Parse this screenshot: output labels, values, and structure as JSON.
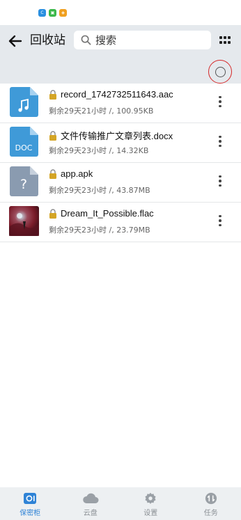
{
  "status_bar": {
    "icons": [
      {
        "name": "app-icon-1",
        "color": "#2a8fe0",
        "glyph": "ℂ"
      },
      {
        "name": "app-icon-2",
        "color": "#3bb84a",
        "glyph": "▣"
      },
      {
        "name": "app-icon-3",
        "color": "#f0a020",
        "glyph": "◈"
      }
    ]
  },
  "header": {
    "title": "回收站",
    "search_placeholder": "搜索"
  },
  "files": [
    {
      "name": "record_1742732511643.aac",
      "meta": "剩余29天21小时 /, 100.95KB",
      "type": "audio",
      "thumb_color": "#3f9ad8"
    },
    {
      "name": "文件传输推广文章列表.docx",
      "meta": "剩余29天23小时 /, 14.32KB",
      "type": "doc",
      "thumb_label": "DOC",
      "thumb_color": "#3f9ad8"
    },
    {
      "name": "app.apk",
      "meta": "剩余29天23小时 /, 43.87MB",
      "type": "unknown",
      "thumb_label": "?",
      "thumb_color": "#8a9bb0"
    },
    {
      "name": "Dream_It_Possible.flac",
      "meta": "剩余29天23小时 /, 23.79MB",
      "type": "image-cover"
    }
  ],
  "bottom_nav": [
    {
      "label": "保密柜",
      "icon": "safe-box-icon",
      "active": true
    },
    {
      "label": "云盘",
      "icon": "cloud-icon",
      "active": false
    },
    {
      "label": "设置",
      "icon": "gear-icon",
      "active": false
    },
    {
      "label": "任务",
      "icon": "transfer-task-icon",
      "active": false
    }
  ],
  "colors": {
    "accent": "#2f83d6",
    "header_bg": "#e5e9ed",
    "select_ring": "#d62828"
  }
}
